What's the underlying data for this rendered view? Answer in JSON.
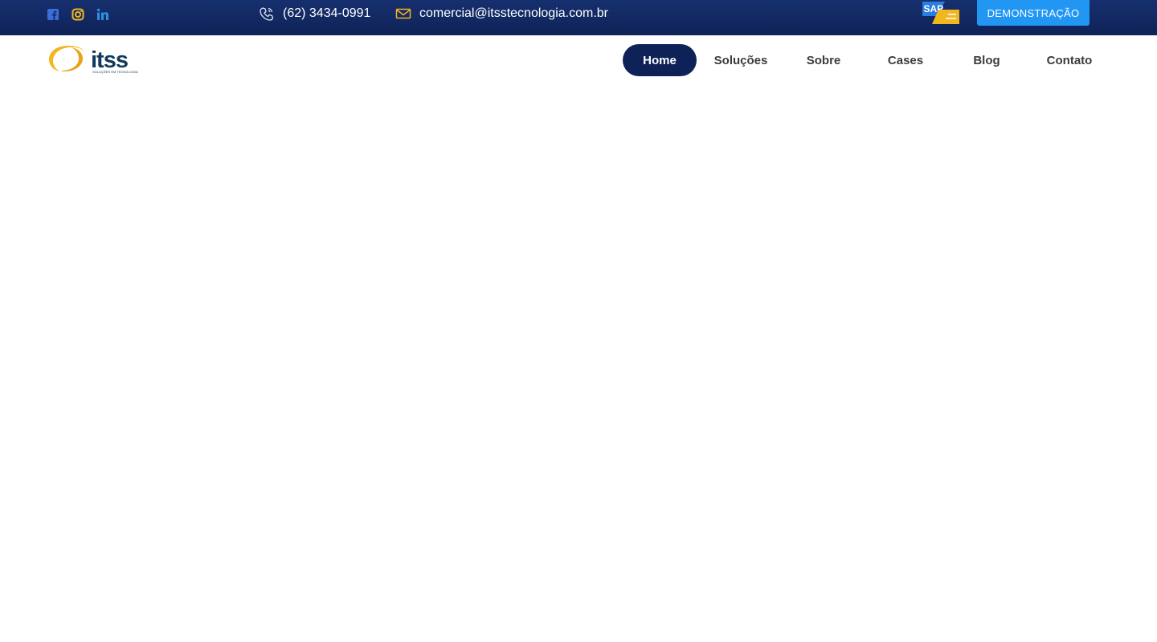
{
  "topbar": {
    "social": {
      "facebook": "facebook-icon",
      "instagram": "instagram-icon",
      "linkedin": "linkedin-icon"
    },
    "phone": "(62) 3434-0991",
    "email": "comercial@itsstecnologia.com.br",
    "demo_label": "DEMONSTRAÇÃO",
    "partner_badge": "SAP"
  },
  "logo": {
    "name": "itss",
    "tagline": "SOLUÇÕES EM TECNOLOGIA"
  },
  "nav": {
    "items": [
      {
        "label": "Home",
        "active": true
      },
      {
        "label": "Soluções"
      },
      {
        "label": "Sobre"
      },
      {
        "label": "Cases"
      },
      {
        "label": "Blog"
      },
      {
        "label": "Contato"
      }
    ]
  },
  "colors": {
    "topbar": "#0f2258",
    "accent": "#2196f3",
    "brand_gold": "#f2b61e",
    "brand_navy": "#0f2258"
  }
}
